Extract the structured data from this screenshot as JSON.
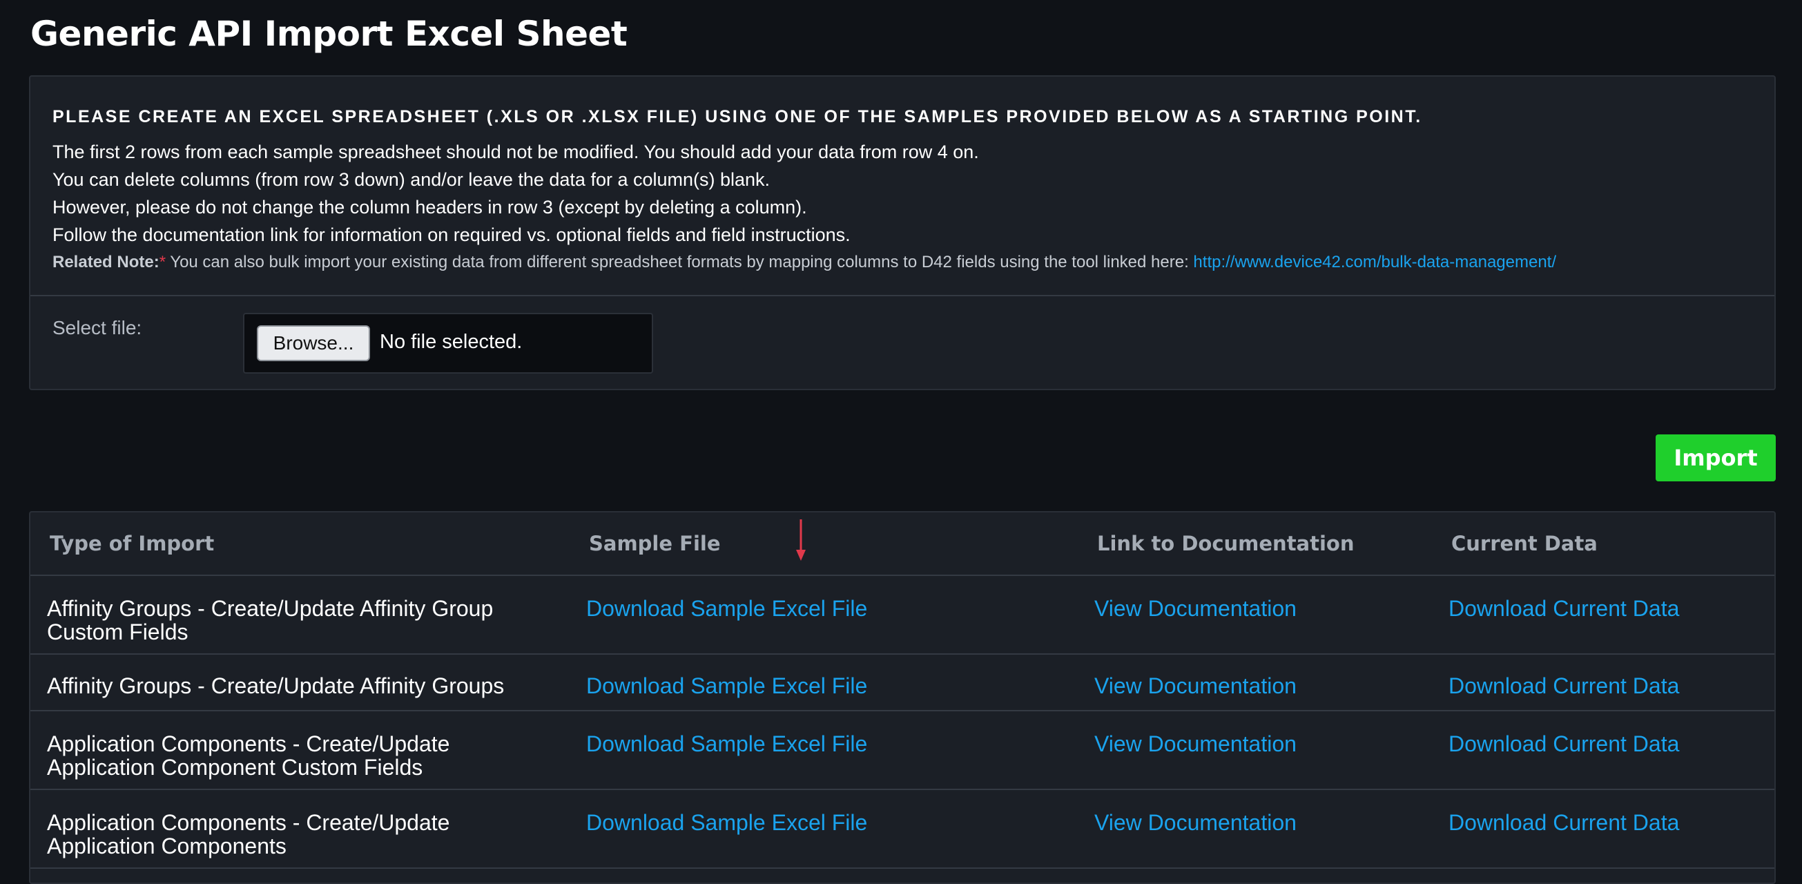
{
  "page": {
    "title": "Generic API Import Excel Sheet"
  },
  "instructions": {
    "heading": "PLEASE CREATE AN EXCEL SPREADSHEET (.XLS OR .XLSX FILE) USING ONE OF THE SAMPLES PROVIDED BELOW AS A STARTING POINT.",
    "lines": [
      "The first 2 rows from each sample spreadsheet should not be modified. You should add your data from row 4 on.",
      "You can delete columns (from row 3 down) and/or leave the data for a column(s) blank.",
      "However, please do not change the column headers in row 3 (except by deleting a column).",
      "Follow the documentation link for information on required vs. optional fields and field instructions."
    ],
    "note_label": "Related Note:",
    "note_asterisk": "*",
    "note_text": " You can also bulk import your existing data from different spreadsheet formats by mapping columns to D42 fields using the tool linked here: ",
    "note_link": "http://www.device42.com/bulk-data-management/"
  },
  "file_select": {
    "label": "Select file:",
    "browse_label": "Browse...",
    "status": "No file selected."
  },
  "import_button": "Import",
  "table": {
    "headers": [
      "Type of Import",
      "Sample File",
      "Link to Documentation",
      "Current Data"
    ],
    "rows": [
      {
        "type_line1": "Affinity Groups - Create/Update Affinity Group",
        "type_line2": "Custom Fields",
        "sample": "Download Sample Excel File",
        "docs": "View Documentation",
        "current": "Download Current Data"
      },
      {
        "type_line1": "Affinity Groups - Create/Update Affinity Groups",
        "type_line2": "",
        "sample": "Download Sample Excel File",
        "docs": "View Documentation",
        "current": "Download Current Data"
      },
      {
        "type_line1": "Application Components - Create/Update",
        "type_line2": "Application Component Custom Fields",
        "sample": "Download Sample Excel File",
        "docs": "View Documentation",
        "current": "Download Current Data"
      },
      {
        "type_line1": "Application Components - Create/Update",
        "type_line2": "Application Components",
        "sample": "Download Sample Excel File",
        "docs": "View Documentation",
        "current": "Download Current Data"
      }
    ]
  },
  "colors": {
    "background": "#0f1217",
    "panel": "#1b1f26",
    "link": "#1aa3ee",
    "import_button": "#1fcf2c",
    "annotation_arrow": "#e0394b"
  }
}
